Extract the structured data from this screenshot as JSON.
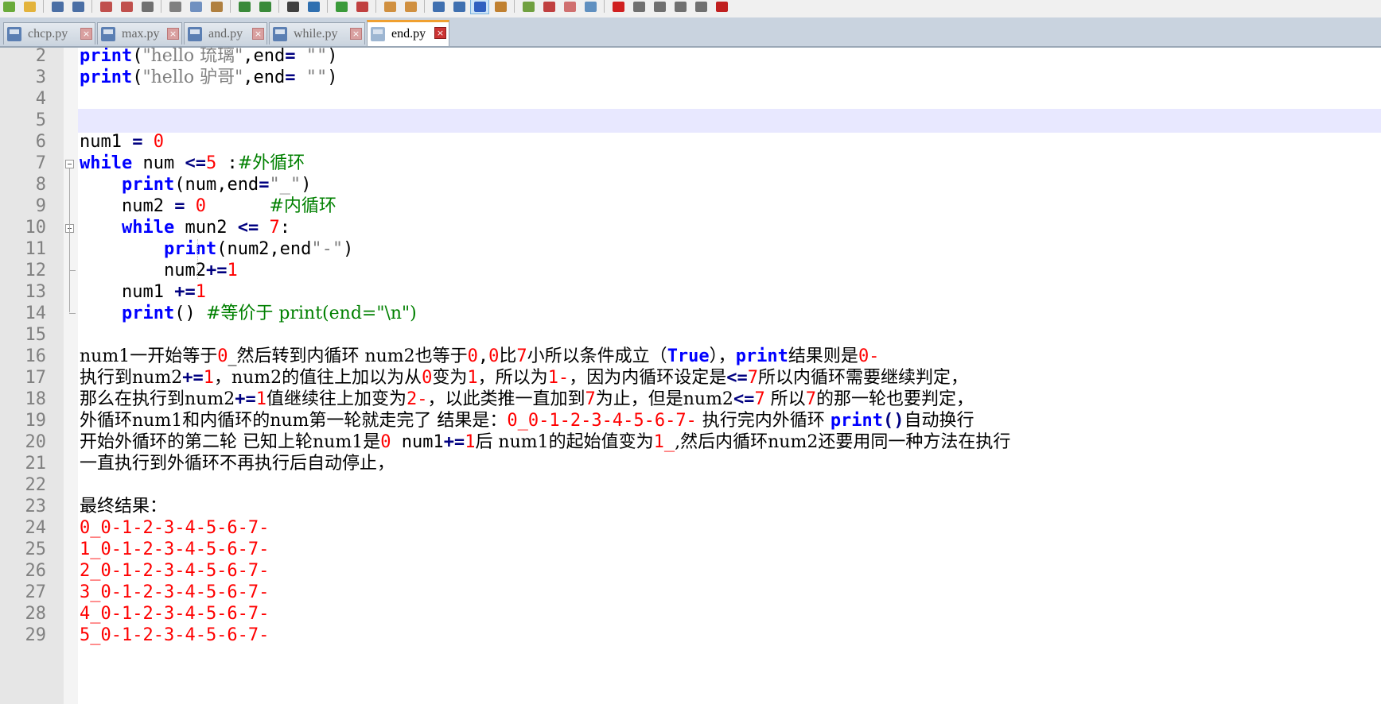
{
  "toolbar": {
    "buttons": [
      {
        "icon": "new-file-icon",
        "color": "#6aaa3a"
      },
      {
        "icon": "open-folder-icon",
        "color": "#e3b33c"
      },
      {
        "icon": "save-icon",
        "color": "#4b6fa5"
      },
      {
        "icon": "save-all-icon",
        "color": "#4b6fa5"
      },
      {
        "icon": "close-icon",
        "color": "#c0504d"
      },
      {
        "icon": "close-all-icon",
        "color": "#c0504d"
      },
      {
        "icon": "print-icon",
        "color": "#707070"
      },
      {
        "icon": "cut-icon",
        "color": "#808080"
      },
      {
        "icon": "copy-icon",
        "color": "#7090c0"
      },
      {
        "icon": "paste-icon",
        "color": "#b08040"
      },
      {
        "icon": "undo-icon",
        "color": "#3a8a3a"
      },
      {
        "icon": "redo-icon",
        "color": "#3a8a3a"
      },
      {
        "icon": "find-icon",
        "color": "#404040"
      },
      {
        "icon": "replace-icon",
        "color": "#3070b0"
      },
      {
        "icon": "zoom-in-icon",
        "color": "#3a9a3a"
      },
      {
        "icon": "zoom-out-icon",
        "color": "#c04040"
      },
      {
        "icon": "sync-vertical-icon",
        "color": "#d09040"
      },
      {
        "icon": "sync-horizontal-icon",
        "color": "#d09040"
      },
      {
        "icon": "word-wrap-icon",
        "color": "#4070b0"
      },
      {
        "icon": "show-all-chars-icon",
        "color": "#4070b0"
      },
      {
        "icon": "indent-guide-icon",
        "color": "#3060c0"
      },
      {
        "icon": "language-icon",
        "color": "#c08030"
      },
      {
        "icon": "doc-map-icon",
        "color": "#70a040"
      },
      {
        "icon": "function-list-icon",
        "color": "#c04040"
      },
      {
        "icon": "folder-workspace-icon",
        "color": "#d07070"
      },
      {
        "icon": "monitor-icon",
        "color": "#6090c0"
      },
      {
        "icon": "record-macro-icon",
        "color": "#d02020"
      },
      {
        "icon": "stop-macro-icon",
        "color": "#707070"
      },
      {
        "icon": "play-macro-icon",
        "color": "#707070"
      },
      {
        "icon": "run-macro-multiple-icon",
        "color": "#707070"
      },
      {
        "icon": "save-macro-icon",
        "color": "#707070"
      },
      {
        "icon": "spell-check-icon",
        "color": "#c02020"
      }
    ]
  },
  "tabs": [
    {
      "label": "chcp.py",
      "active": false
    },
    {
      "label": "max.py",
      "active": false
    },
    {
      "label": "and.py",
      "active": false
    },
    {
      "label": "while.py",
      "active": false
    },
    {
      "label": "end.py",
      "active": true
    }
  ],
  "editor": {
    "current_line": 5,
    "lines": [
      {
        "n": "2",
        "tokens": [
          [
            "kw",
            "print"
          ],
          [
            "tx",
            "("
          ],
          [
            "str",
            "\"hello 琉璃\""
          ],
          [
            "tx",
            ",end"
          ],
          [
            "op",
            "="
          ],
          [
            "tx",
            " "
          ],
          [
            "str",
            "\"\""
          ],
          [
            "tx",
            ")"
          ]
        ]
      },
      {
        "n": "3",
        "tokens": [
          [
            "kw",
            "print"
          ],
          [
            "tx",
            "("
          ],
          [
            "str",
            "\"hello 驴哥\""
          ],
          [
            "tx",
            ",end"
          ],
          [
            "op",
            "="
          ],
          [
            "tx",
            " "
          ],
          [
            "str",
            "\"\""
          ],
          [
            "tx",
            ")"
          ]
        ]
      },
      {
        "n": "4",
        "tokens": []
      },
      {
        "n": "5",
        "tokens": []
      },
      {
        "n": "6",
        "tokens": [
          [
            "tx",
            "num1 "
          ],
          [
            "op",
            "="
          ],
          [
            "tx",
            " "
          ],
          [
            "num",
            "0"
          ]
        ]
      },
      {
        "n": "7",
        "tokens": [
          [
            "kw",
            "while"
          ],
          [
            "tx",
            " num "
          ],
          [
            "op",
            "<="
          ],
          [
            "num",
            "5"
          ],
          [
            "tx",
            " :"
          ],
          [
            "cm",
            "#外循环"
          ]
        ]
      },
      {
        "n": "8",
        "tokens": [
          [
            "tx",
            "    "
          ],
          [
            "kw",
            "print"
          ],
          [
            "tx",
            "(num,end"
          ],
          [
            "op",
            "="
          ],
          [
            "str",
            "\"_\""
          ],
          [
            "tx",
            ")"
          ]
        ]
      },
      {
        "n": "9",
        "tokens": [
          [
            "tx",
            "    num2 "
          ],
          [
            "op",
            "="
          ],
          [
            "tx",
            " "
          ],
          [
            "num",
            "0"
          ],
          [
            "tx",
            "      "
          ],
          [
            "cm",
            "#内循环"
          ]
        ]
      },
      {
        "n": "10",
        "tokens": [
          [
            "tx",
            "    "
          ],
          [
            "kw",
            "while"
          ],
          [
            "tx",
            " mun2 "
          ],
          [
            "op",
            "<="
          ],
          [
            "tx",
            " "
          ],
          [
            "num",
            "7"
          ],
          [
            "tx",
            ":"
          ]
        ]
      },
      {
        "n": "11",
        "tokens": [
          [
            "tx",
            "        "
          ],
          [
            "kw",
            "print"
          ],
          [
            "tx",
            "(num2,end"
          ],
          [
            "str",
            "\"-\""
          ],
          [
            "tx",
            ")"
          ]
        ]
      },
      {
        "n": "12",
        "tokens": [
          [
            "tx",
            "        num2"
          ],
          [
            "op",
            "+="
          ],
          [
            "num",
            "1"
          ]
        ]
      },
      {
        "n": "13",
        "tokens": [
          [
            "tx",
            "    num1 "
          ],
          [
            "op",
            "+="
          ],
          [
            "num",
            "1"
          ]
        ]
      },
      {
        "n": "14",
        "tokens": [
          [
            "tx",
            "    "
          ],
          [
            "kw",
            "print"
          ],
          [
            "tx",
            "() "
          ],
          [
            "cm",
            "#等价于 print(end=\"\\n\")"
          ]
        ]
      },
      {
        "n": "15",
        "tokens": []
      },
      {
        "n": "16",
        "tokens": [
          [
            "tx",
            "num1一开始等于"
          ],
          [
            "num",
            "0"
          ],
          [
            "tx",
            "_然后转到内循环 num2也等于"
          ],
          [
            "num",
            "0"
          ],
          [
            "tx",
            ","
          ],
          [
            "num",
            "0"
          ],
          [
            "tx",
            "比"
          ],
          [
            "num",
            "7"
          ],
          [
            "tx",
            "小所以条件成立（"
          ],
          [
            "kw",
            "True"
          ],
          [
            "tx",
            "），"
          ],
          [
            "kw",
            "print"
          ],
          [
            "tx",
            "结果则是"
          ],
          [
            "num",
            "0-"
          ]
        ]
      },
      {
        "n": "17",
        "tokens": [
          [
            "tx",
            "执行到num2"
          ],
          [
            "op",
            "+="
          ],
          [
            "num",
            "1"
          ],
          [
            "tx",
            "，num2的值往上加以为从"
          ],
          [
            "num",
            "0"
          ],
          [
            "tx",
            "变为"
          ],
          [
            "num",
            "1"
          ],
          [
            "tx",
            "，所以为"
          ],
          [
            "num",
            "1-"
          ],
          [
            "tx",
            "，因为内循环设定是"
          ],
          [
            "op",
            "<="
          ],
          [
            "num",
            "7"
          ],
          [
            "tx",
            "所以内循环需要继续判定，"
          ]
        ]
      },
      {
        "n": "18",
        "tokens": [
          [
            "tx",
            "那么在执行到num2"
          ],
          [
            "op",
            "+="
          ],
          [
            "num",
            "1"
          ],
          [
            "tx",
            "值继续往上加变为"
          ],
          [
            "num",
            "2-"
          ],
          [
            "tx",
            "，以此类推一直加到"
          ],
          [
            "num",
            "7"
          ],
          [
            "tx",
            "为止，但是num2"
          ],
          [
            "op",
            "<="
          ],
          [
            "num",
            "7"
          ],
          [
            "tx",
            " 所以"
          ],
          [
            "num",
            "7"
          ],
          [
            "tx",
            "的那一轮也要判定，"
          ]
        ]
      },
      {
        "n": "19",
        "tokens": [
          [
            "tx",
            "外循环num1和内循环的num第一轮就走完了 结果是："
          ],
          [
            "num",
            "0_0-1-2-3-4-5-6-7-"
          ],
          [
            "tx",
            " 执行完内外循环 "
          ],
          [
            "kw",
            "print"
          ],
          [
            "op",
            "()"
          ],
          [
            "tx",
            "自动换行"
          ]
        ]
      },
      {
        "n": "20",
        "tokens": [
          [
            "tx",
            "开始外循环的第二轮 已知上轮num1是"
          ],
          [
            "num",
            "0"
          ],
          [
            "tx",
            " num1"
          ],
          [
            "op",
            "+="
          ],
          [
            "num",
            "1"
          ],
          [
            "tx",
            "后 num1的起始值变为"
          ],
          [
            "num",
            "1_"
          ],
          [
            "tx",
            ",然后内循环num2还要用同一种方法在执行"
          ]
        ]
      },
      {
        "n": "21",
        "tokens": [
          [
            "tx",
            "一直执行到外循环不再执行后自动停止，"
          ]
        ]
      },
      {
        "n": "22",
        "tokens": []
      },
      {
        "n": "23",
        "tokens": [
          [
            "tx",
            "最终结果："
          ]
        ]
      },
      {
        "n": "24",
        "tokens": [
          [
            "num",
            "0_0-1-2-3-4-5-6-7-"
          ]
        ]
      },
      {
        "n": "25",
        "tokens": [
          [
            "num",
            "1_0-1-2-3-4-5-6-7-"
          ]
        ]
      },
      {
        "n": "26",
        "tokens": [
          [
            "num",
            "2_0-1-2-3-4-5-6-7-"
          ]
        ]
      },
      {
        "n": "27",
        "tokens": [
          [
            "num",
            "3_0-1-2-3-4-5-6-7-"
          ]
        ]
      },
      {
        "n": "28",
        "tokens": [
          [
            "num",
            "4_0-1-2-3-4-5-6-7-"
          ]
        ]
      },
      {
        "n": "29",
        "tokens": [
          [
            "num",
            "5_0-1-2-3-4-5-6-7-"
          ]
        ]
      }
    ]
  }
}
